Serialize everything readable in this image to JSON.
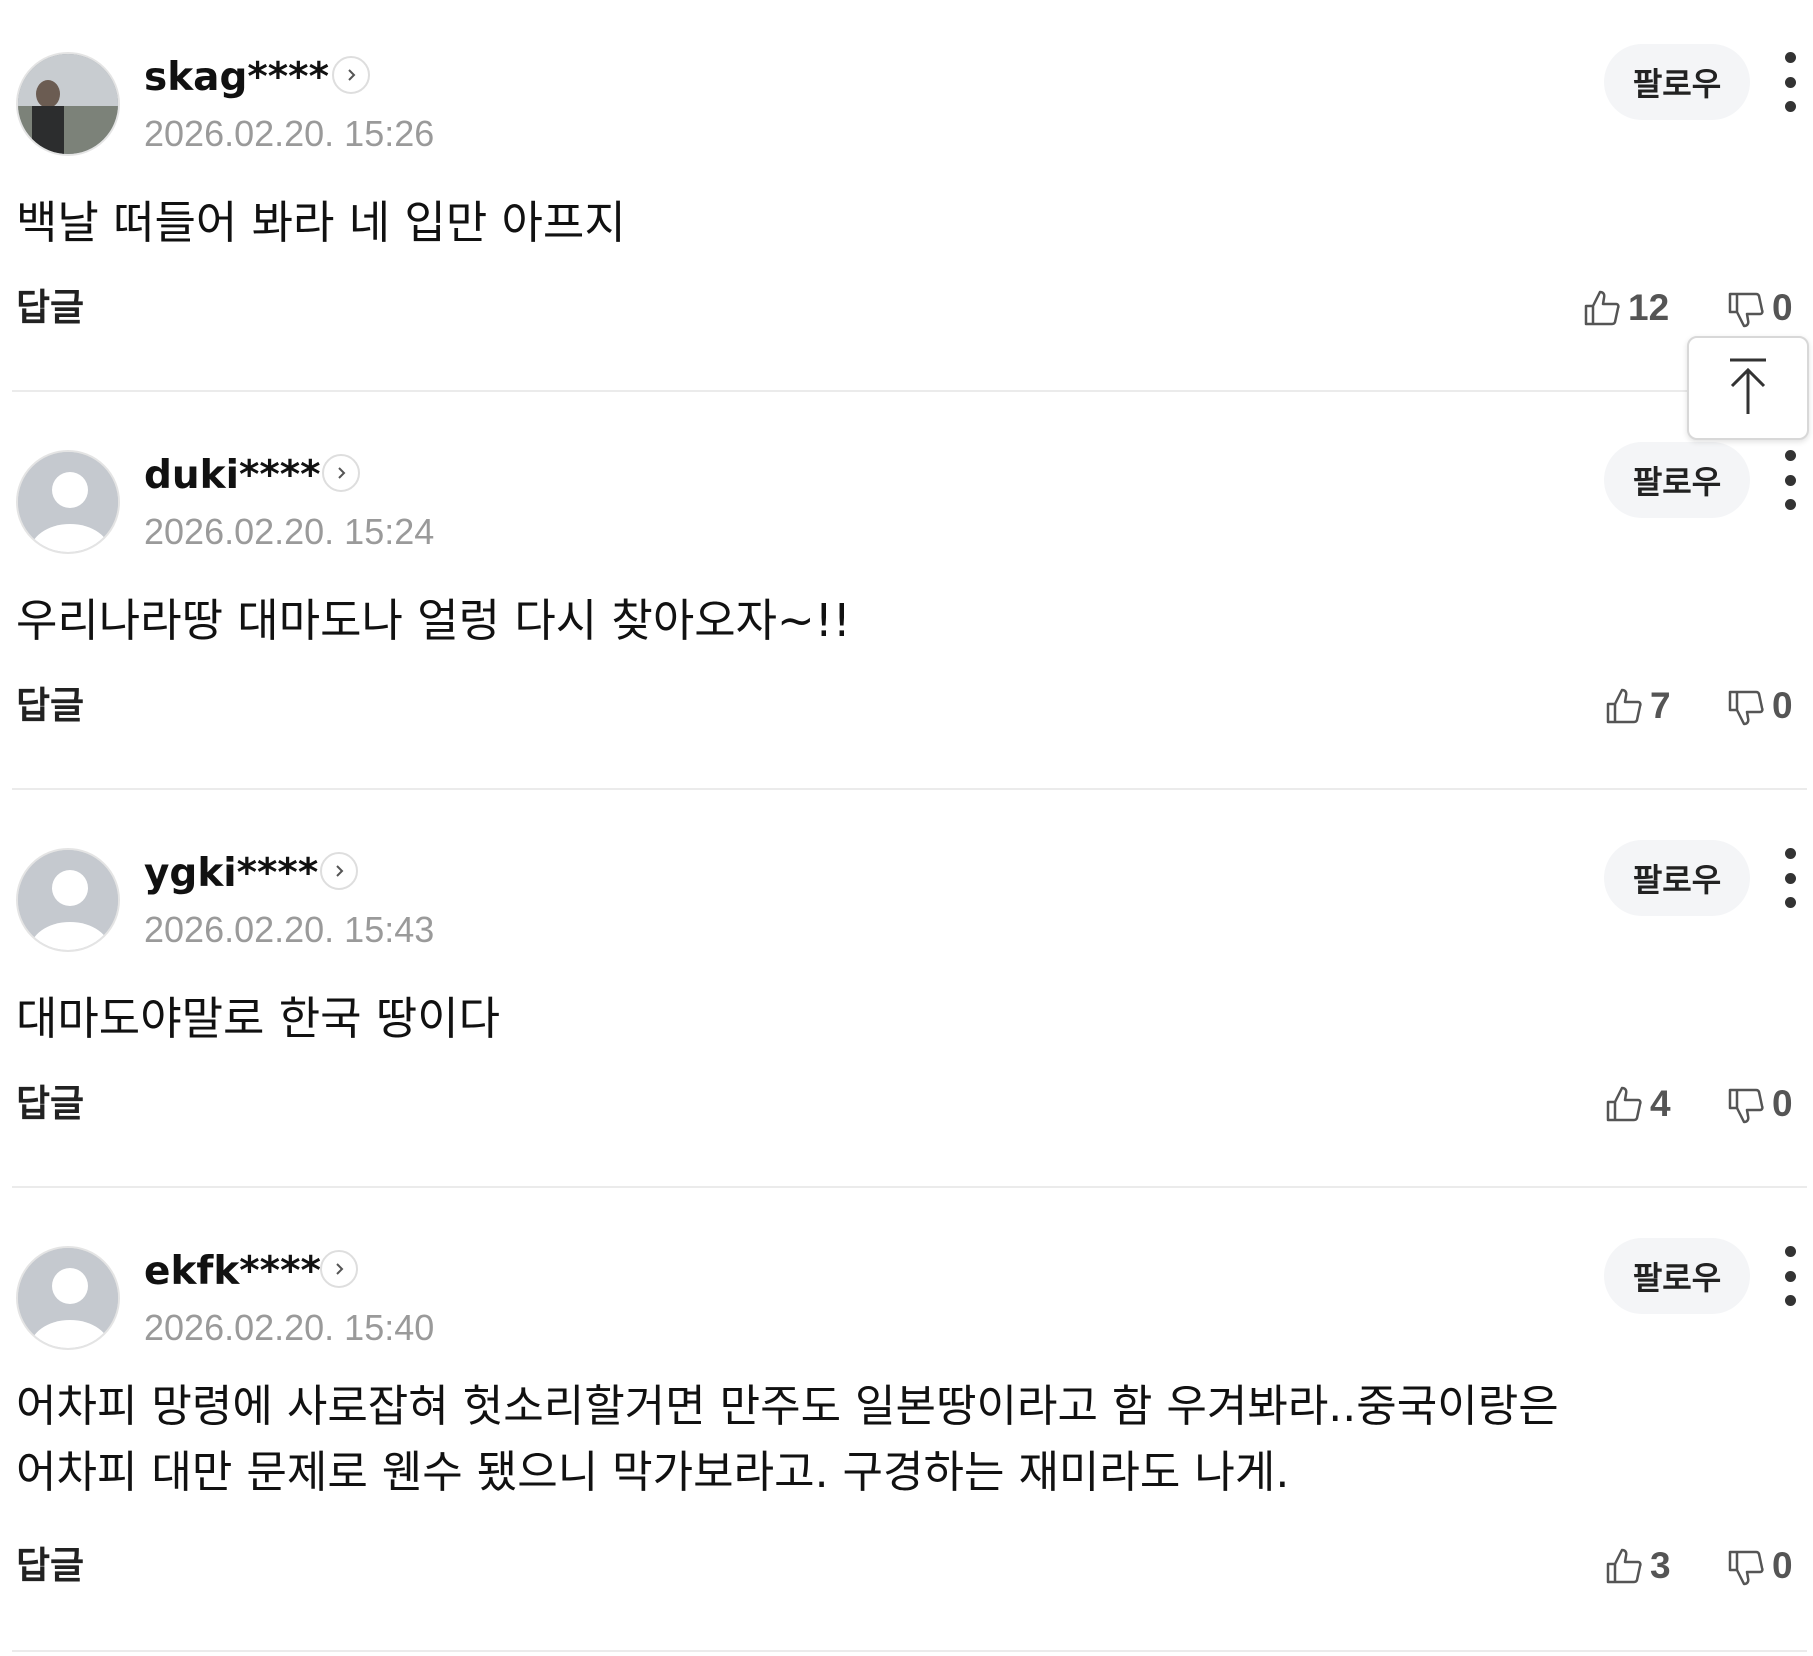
{
  "ui": {
    "follow_label": "팔로우",
    "reply_label": "답글"
  },
  "comments": [
    {
      "username": "skag****",
      "timestamp": "2026.02.20. 15:26",
      "text": "백날 떠들어 봐라 네 입만 아프지",
      "likes": "12",
      "dislikes": "0",
      "avatar": "photo"
    },
    {
      "username": "duki****",
      "timestamp": "2026.02.20. 15:24",
      "text": "우리나라땅 대마도나 얼렁 다시 찾아오자~!!",
      "likes": "7",
      "dislikes": "0",
      "avatar": "default-avatar-icon"
    },
    {
      "username": "ygki****",
      "timestamp": "2026.02.20. 15:43",
      "text": "대마도야말로 한국 땅이다",
      "likes": "4",
      "dislikes": "0",
      "avatar": "default-avatar-icon"
    },
    {
      "username": "ekfk****",
      "timestamp": "2026.02.20. 15:40",
      "text": "어차피 망령에 사로잡혀 헛소리할거면 만주도 일본땅이라고 함 우겨봐라..중국이랑은\n어차피 대만 문제로 웬수 됐으니 막가보라고. 구경하는 재미라도 나게.",
      "likes": "3",
      "dislikes": "0",
      "avatar": "default-avatar-icon"
    }
  ],
  "icons": {
    "profile_link": "chevron-right-icon",
    "more": "more-vertical-icon",
    "like": "thumbs-up-icon",
    "dislike": "thumbs-down-icon",
    "scroll_top": "arrow-up-to-top-icon"
  },
  "colors": {
    "timestamp": "#9a9a9a",
    "follow_bg": "#f4f5f7",
    "divider": "#ebebeb",
    "avatar_default": "#c5c9cf"
  }
}
